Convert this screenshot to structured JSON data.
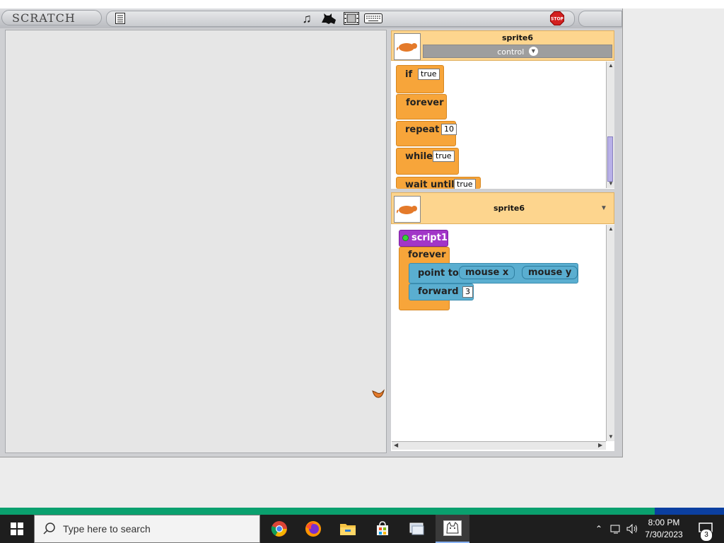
{
  "app": {
    "logo": "SCRATCH",
    "stop_label": "STOP"
  },
  "palette": {
    "sprite_name": "sprite6",
    "category": "control",
    "blocks": [
      {
        "label": "if",
        "arg": "true"
      },
      {
        "label": "forever"
      },
      {
        "label": "repeat",
        "arg": "10"
      },
      {
        "label": "while",
        "arg": "true"
      },
      {
        "label": "wait until",
        "arg": "true"
      }
    ]
  },
  "scripts": {
    "sprite_name": "sprite6",
    "script_name": "script1",
    "forever_label": "forever",
    "point_to_label": "point to",
    "mouse_x": "mouse x",
    "mouse_y": "mouse y",
    "forward_label": "forward",
    "forward_arg": "3"
  },
  "taskbar": {
    "search_placeholder": "Type here to search",
    "time": "8:00 PM",
    "date": "7/30/2023",
    "notification_count": "3"
  },
  "colors": {
    "control": "#f7a53a",
    "motion": "#5aaed0",
    "script_hat": "#a236c8",
    "header": "#fdd58e",
    "taskbar_progress": "#0aa06e"
  }
}
